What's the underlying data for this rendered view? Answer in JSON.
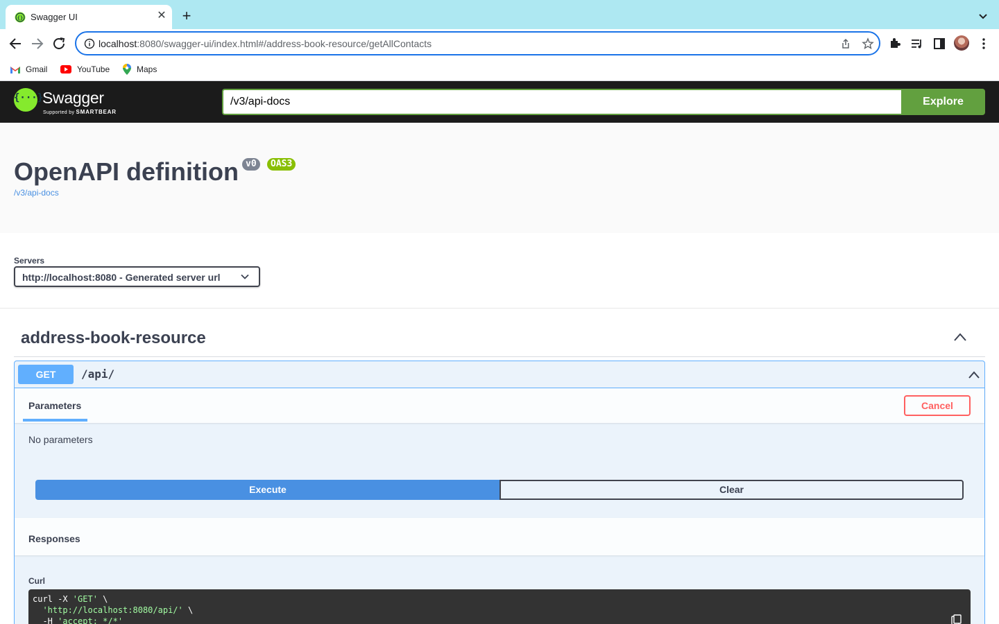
{
  "browser": {
    "tab_title": "Swagger UI",
    "url_host": "localhost",
    "url_rest": ":8080/swagger-ui/index.html#/address-book-resource/getAllContacts",
    "bookmarks": [
      "Gmail",
      "YouTube",
      "Maps"
    ]
  },
  "topbar": {
    "logo_word": "Swagger",
    "logo_sub_prefix": "Supported by",
    "logo_sub_brand": "SMARTBEAR",
    "spec_url": "/v3/api-docs",
    "explore_label": "Explore"
  },
  "info": {
    "title": "OpenAPI definition",
    "version_badge": "v0",
    "oas_badge": "OAS3",
    "spec_link": "/v3/api-docs"
  },
  "servers": {
    "label": "Servers",
    "selected": "http://localhost:8080 - Generated server url"
  },
  "tag": {
    "name": "address-book-resource"
  },
  "operation": {
    "method": "GET",
    "path": "/api/",
    "parameters_tab": "Parameters",
    "cancel_label": "Cancel",
    "no_params": "No parameters",
    "execute_label": "Execute",
    "clear_label": "Clear",
    "responses_title": "Responses",
    "curl_label": "Curl",
    "curl": {
      "line1_cmd": "curl -X ",
      "line1_method": "'GET'",
      "line1_end": " \\",
      "line2_indent": "  ",
      "line2_url": "'http://localhost:8080/api/'",
      "line2_end": " \\",
      "line3_flag": "  -H ",
      "line3_header": "'accept: */*'"
    }
  },
  "colors": {
    "get_blue": "#61affe",
    "swagger_green": "#62a03f",
    "cancel_red": "#ff6060",
    "execute_blue": "#4990e2"
  }
}
